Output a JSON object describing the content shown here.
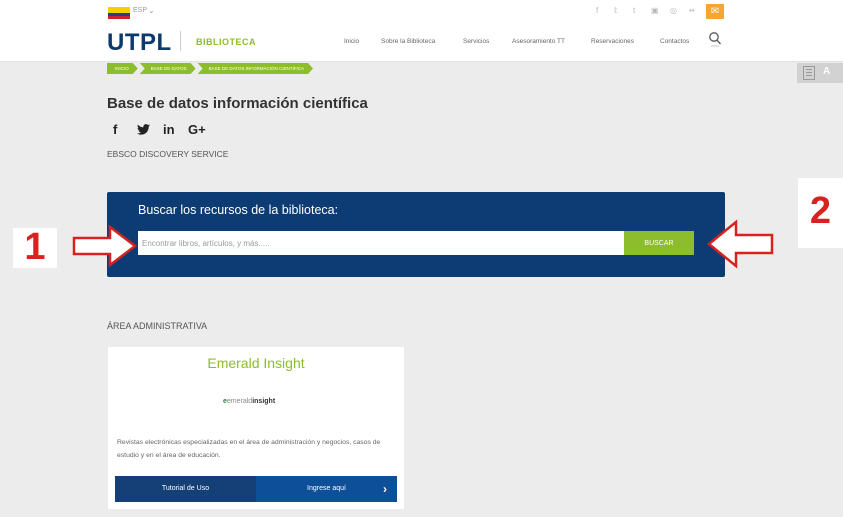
{
  "header": {
    "lang_label": "ESP",
    "logo": "UTPL",
    "logo_sub": "BIBLIOTECA",
    "nav": [
      "Inicio",
      "Sobre la Biblioteca",
      "Servicios",
      "Asesoramiento TT",
      "Reservaciones",
      "Contactos"
    ],
    "social_icons": [
      "facebook-icon",
      "twitter-icon",
      "tumblr-icon",
      "youtube-icon",
      "instagram-icon",
      "flickr-icon",
      "mail-icon"
    ],
    "colors": {
      "brand_blue": "#0d3a6e",
      "brand_green": "#8cbd2c",
      "mail_orange": "#f6a531"
    }
  },
  "breadcrumb": [
    "INICIO",
    "BASE DE DATOS",
    "BASE DE DATOS INFORMACIÓN CIENTÍFICA"
  ],
  "page": {
    "title": "Base de datos información científica",
    "share_icons": [
      "facebook-icon",
      "twitter-icon",
      "linkedin-icon",
      "google-plus-icon"
    ],
    "subtitle": "EBSCO DISCOVERY SERVICE"
  },
  "search": {
    "title": "Buscar los recursos de la biblioteca:",
    "placeholder": "Encontrar libros, artículos, y más.....",
    "button": "BUSCAR"
  },
  "annotations": {
    "left": "1",
    "right": "2"
  },
  "admin": {
    "title": "ÁREA ADMINISTRATIVA",
    "card": {
      "title": "Emerald Insight",
      "logo_e": "e",
      "logo_em": "emerald",
      "logo_ins": "insight",
      "description": "Revistas electrónicas especializadas en el área de administración y negocios, casos de estudio y en el área de educación.",
      "btn_tutorial": "Tutorial de Uso",
      "btn_ingrese": "Ingrese aquí"
    }
  }
}
